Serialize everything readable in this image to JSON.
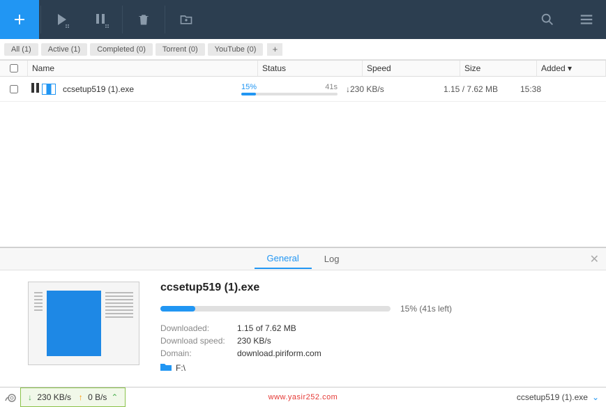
{
  "filters": {
    "all": "All (1)",
    "active": "Active (1)",
    "completed": "Completed (0)",
    "torrent": "Torrent (0)",
    "youtube": "YouTube (0)"
  },
  "columns": {
    "name": "Name",
    "status": "Status",
    "speed": "Speed",
    "size": "Size",
    "added": "Added"
  },
  "row": {
    "name": "ccsetup519 (1).exe",
    "percent": "15%",
    "eta": "41s",
    "speed": "↓230 KB/s",
    "size": "1.15 / 7.62 MB",
    "added": "15:38"
  },
  "tabs": {
    "general": "General",
    "log": "Log"
  },
  "details": {
    "title": "ccsetup519 (1).exe",
    "progress_text": "15% (41s left)",
    "downloaded_label": "Downloaded:",
    "downloaded_val": "1.15 of 7.62 MB",
    "speed_label": "Download speed:",
    "speed_val": "230 KB/s",
    "domain_label": "Domain:",
    "domain_val": "download.piriform.com",
    "path": "F:\\"
  },
  "bottom": {
    "down_speed": "230 KB/s",
    "up_speed": "0 B/s",
    "current_file": "ccsetup519 (1).exe"
  },
  "watermark": "www.yasir252.com"
}
